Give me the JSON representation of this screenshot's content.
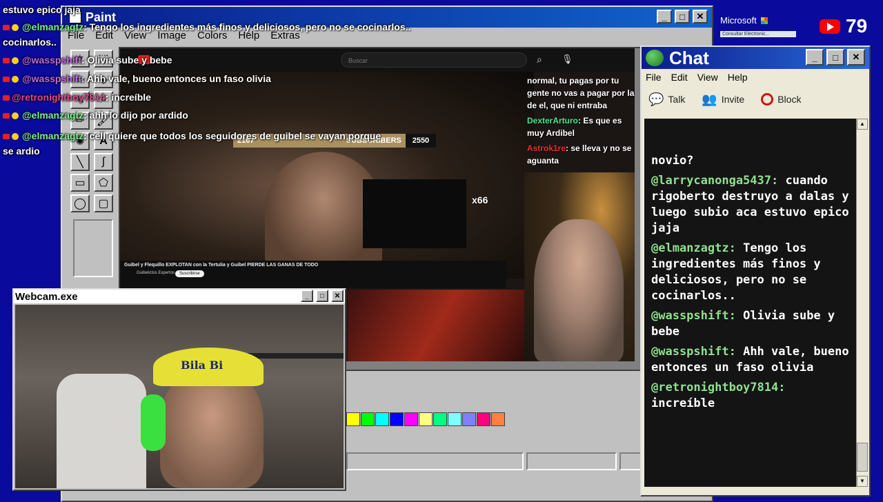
{
  "paint": {
    "title": "Paint",
    "menu": [
      "File",
      "Edit",
      "View",
      "Image",
      "Colors",
      "Help",
      "Extras"
    ],
    "palette": [
      "#ffff00",
      "#00ff00",
      "#00ffff",
      "#0000ff",
      "#ff00ff",
      "#ffff80",
      "#00ff80",
      "#80ffff",
      "#8080ff",
      "#ff0080",
      "#ff8040"
    ]
  },
  "stream": {
    "search_placeholder": "Buscar",
    "subscribers_left": "2167",
    "subscribers_label": "SUBSCRIBERS",
    "subscribers_right": "2550",
    "video_title": "Guibel y Flequillo EXPLOTAN con la Tertulia y Guibel PIERDE LAS GANAS DE TODO",
    "channel": "Guibelictos Expertos",
    "subscribe_label": "Suscribirse",
    "badge": "x66",
    "side_chat": [
      {
        "user": "",
        "text": "normal, tu pagas por tu gente no vas a pagar por la de el, que ni entraba"
      },
      {
        "user": "DexterArturo",
        "text": ": Es que es muy Ardibel"
      },
      {
        "user": "Astrok1re",
        "text": ": se lleva y no se aguanta"
      }
    ]
  },
  "overlay_chat": [
    {
      "user": "",
      "text": "estuvo epico jaja"
    },
    {
      "user": "@elmanzagtz",
      "text": ": Tengo los ingredientes más finos y deliciosos, pero no se cocinarlos.."
    },
    {
      "user": "@wasspshift",
      "text": ": Olivia sube y bebe"
    },
    {
      "user": "@wasspshift",
      "text": ": Ahh vale, bueno entonces un faso olivia"
    },
    {
      "user": "@retronightboy7814",
      "text": ": increíble"
    },
    {
      "user": "@elmanzagtz",
      "text": ": ahh lo dijo por ardido"
    },
    {
      "user": "@elmanzagtz",
      "text": ": cell quiere que todos los seguidores de guibel se vayan porque se ardio"
    }
  ],
  "chat": {
    "title": "Chat",
    "menu": [
      "File",
      "Edit",
      "View",
      "Help"
    ],
    "toolbar": [
      "Talk",
      "Invite",
      "Block"
    ],
    "messages": [
      {
        "user": "",
        "text": "novio?"
      },
      {
        "user": "@larrycanonga5437:",
        "text": "cuando rigoberto destruyo a dalas y luego subio aca estuvo epico jaja"
      },
      {
        "user": "@elmanzagtz:",
        "text": "Tengo los ingredientes más finos y deliciosos, pero no se cocinarlos.."
      },
      {
        "user": "@wasspshift:",
        "text": "Olivia sube y bebe"
      },
      {
        "user": "@wasspshift:",
        "text": "Ahh vale, bueno entonces un faso olivia"
      },
      {
        "user": "@retronightboy7814:",
        "text": "increíble"
      }
    ]
  },
  "webcam": {
    "title": "Webcam.exe",
    "cap_text": "Bila Bi"
  },
  "msn": {
    "brand": "Microsoft",
    "link": "Consultar Electronic..."
  },
  "viewers": {
    "count": "79"
  }
}
